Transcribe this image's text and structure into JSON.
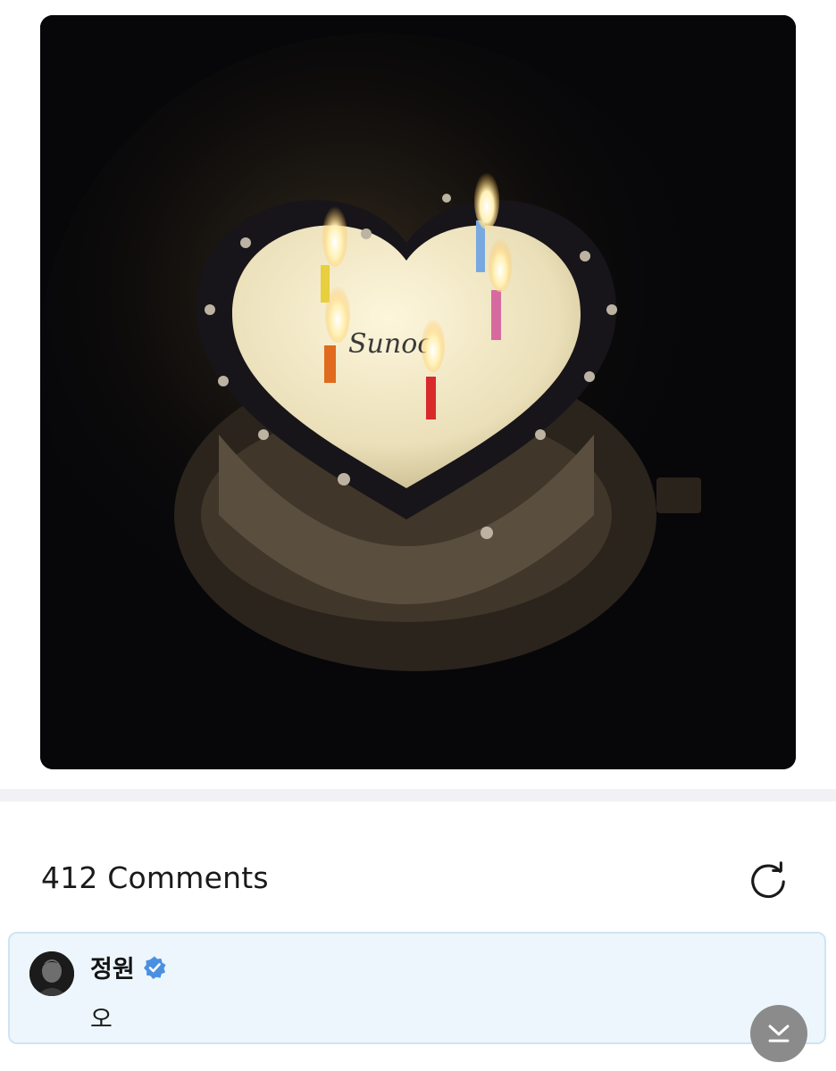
{
  "post": {
    "image_alt": "Heart-shaped birthday cake with five lit candles in the dark",
    "cake_writing": "Sunoo"
  },
  "comments": {
    "count_label": "412 Comments",
    "refresh_icon": "refresh-icon"
  },
  "comment": {
    "author": "정원",
    "verified_icon": "verified-badge-icon",
    "text": "오"
  },
  "controls": {
    "scroll_down_icon": "chevron-down-to-bottom-icon"
  },
  "colors": {
    "verified": "#4a90e2",
    "card_bg": "#edf6fc",
    "card_border": "#cfe4f3",
    "scroll_button": "#8b8b8b"
  }
}
